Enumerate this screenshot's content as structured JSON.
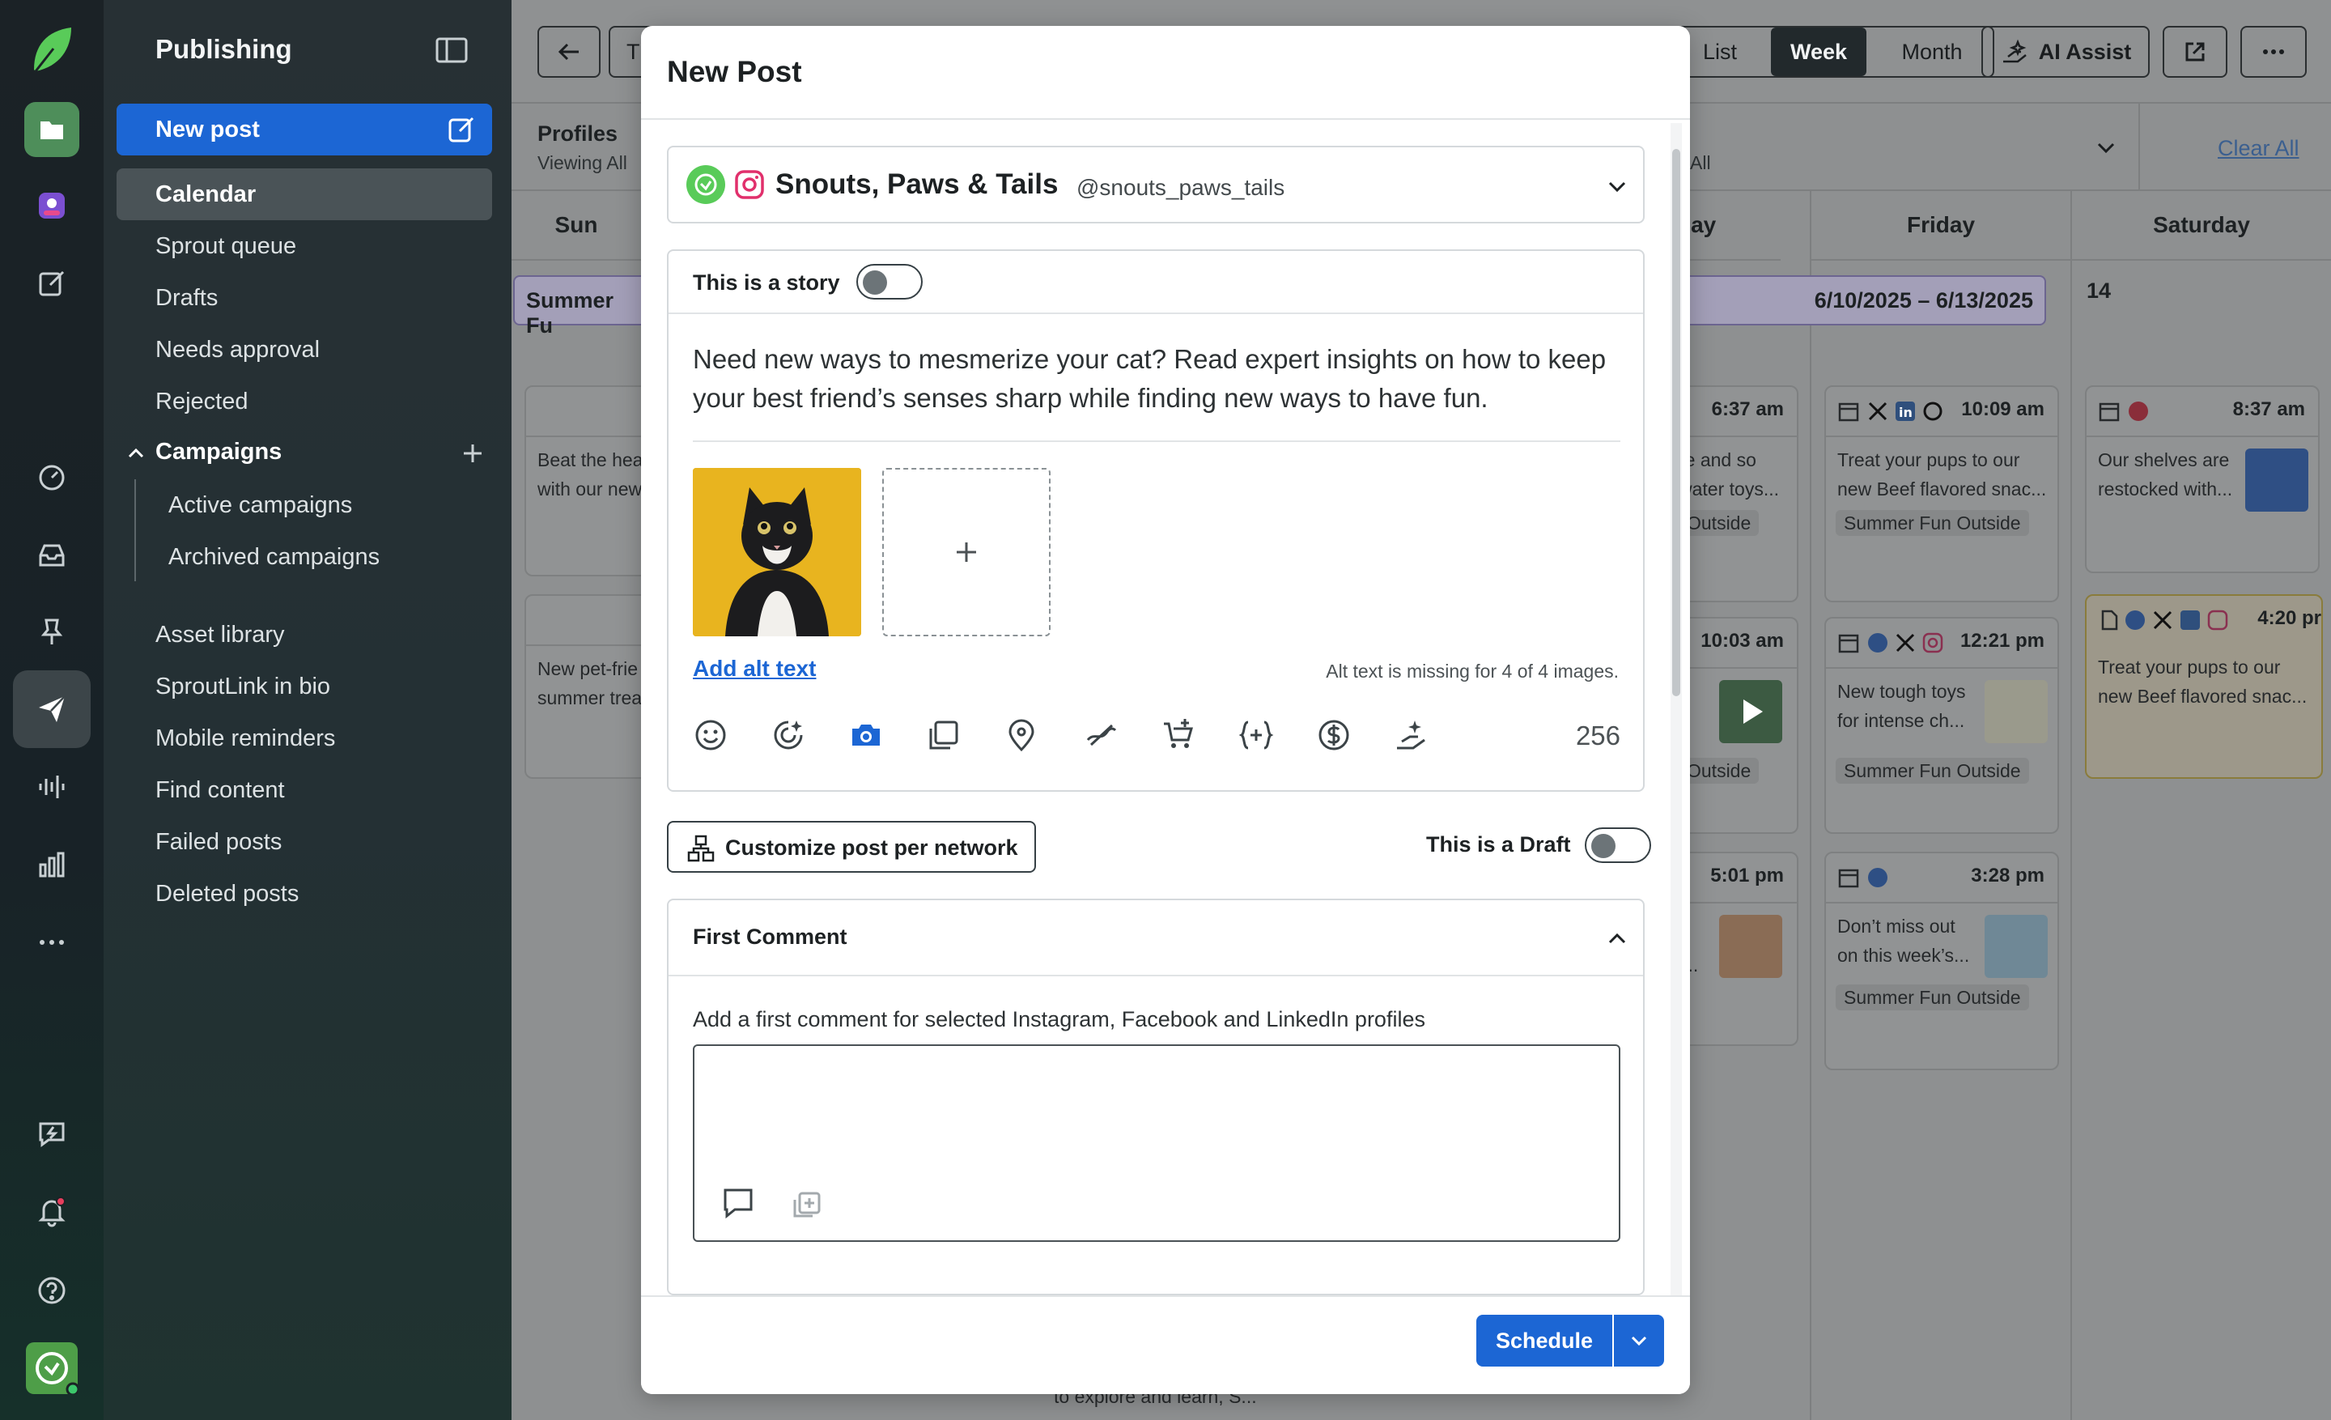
{
  "colors": {
    "accent": "#1c66d4",
    "rail": "#1b2226",
    "nav": "#273034",
    "instagram": "#e1306c",
    "facebook": "#1877f2",
    "linkedin": "#0a66c2",
    "pinterest": "#e60023",
    "brand_green": "#59cb59",
    "campaign_purple": "#b9a9e8"
  },
  "rail": {
    "icons": [
      "folder-icon",
      "profile-app-icon",
      "compose-icon",
      "dashboard-icon",
      "inbox-icon",
      "pin-icon",
      "send-icon",
      "listening-icon",
      "reports-icon",
      "more-icon",
      "feedback-icon",
      "bell-icon",
      "help-icon",
      "brand-avatar"
    ]
  },
  "nav": {
    "title": "Publishing",
    "new_post": "New post",
    "calendar": "Calendar",
    "items_top": [
      "Sprout queue",
      "Drafts",
      "Needs approval",
      "Rejected"
    ],
    "campaigns": "Campaigns",
    "campaign_items": [
      "Active campaigns",
      "Archived campaigns"
    ],
    "items_bottom": [
      "Asset library",
      "SproutLink in bio",
      "Mobile reminders",
      "Find content",
      "Failed posts",
      "Deleted posts"
    ]
  },
  "calendar": {
    "view_list": "List",
    "view_week": "Week",
    "view_month": "Month",
    "ai_assist": "AI Assist",
    "today_partial": "T",
    "profiles_label": "Profiles",
    "viewing_all": "Viewing All",
    "filter_all": "All",
    "clear_all": "Clear All",
    "days": {
      "sun": "Sun",
      "thu": "day",
      "fri": "Friday",
      "sat": "Saturday"
    },
    "campaign_bar_left": "Summer Fu",
    "campaign_bar_range": "6/10/2025 – 6/13/2025",
    "sat_date": "14",
    "cards": {
      "sun1_text": [
        "Beat the hea",
        "with our new"
      ],
      "sun2_text": [
        "New pet-frie",
        "summer trea"
      ],
      "thu1_time": "6:37 am",
      "thu1_text": [
        "re and so",
        "water toys..."
      ],
      "thu1_tag": "Outside",
      "thu2_time": "10:03 am",
      "thu2_tag": "Outside",
      "thu3_time": "5:01 pm",
      "thu3_text": "i...",
      "fri1_time": "10:09 am",
      "fri1_text": [
        "Treat your pups to our",
        "new Beef flavored snac..."
      ],
      "fri1_tag": "Summer Fun Outside",
      "fri2_time": "12:21 pm",
      "fri2_text": [
        "New tough toys",
        "for intense ch..."
      ],
      "fri2_tag": "Summer Fun Outside",
      "fri3_time": "3:28 pm",
      "fri3_text": [
        "Don’t miss out",
        "on this week’s..."
      ],
      "fri3_tag": "Summer Fun Outside",
      "sat1_time": "8:37 am",
      "sat1_text": [
        "Our shelves are",
        "restocked with..."
      ],
      "sat2_time": "4:20 pr",
      "sat2_text": [
        "Treat your pups to our",
        "new Beef flavored snac..."
      ],
      "bottom_text": "to explore and learn, S..."
    }
  },
  "modal": {
    "title": "New Post",
    "profile_name": "Snouts, Paws & Tails",
    "profile_handle": "@snouts_paws_tails",
    "story_label": "This is a story",
    "story_on": false,
    "post_text": "Need new ways to mesmerize your cat? Read expert insights on how to keep your best friend’s senses sharp while finding new ways to have fun.",
    "add_alt_text": "Add alt text",
    "alt_text_msg": "Alt text is missing for 4 of 4 images.",
    "tools": [
      "emoji-icon",
      "ai-assist-icon",
      "camera-icon",
      "gallery-icon",
      "location-icon",
      "link-tracking-icon",
      "product-tag-icon",
      "variable-icon",
      "dollar-icon",
      "ai-hand-icon"
    ],
    "char_count": "256",
    "customize_label": "Customize post per network",
    "draft_label": "This is a Draft",
    "draft_on": false,
    "first_comment_title": "First Comment",
    "first_comment_desc": "Add a first comment for selected Instagram, Facebook and LinkedIn profiles",
    "first_comment_value": "",
    "schedule_label": "Schedule"
  }
}
